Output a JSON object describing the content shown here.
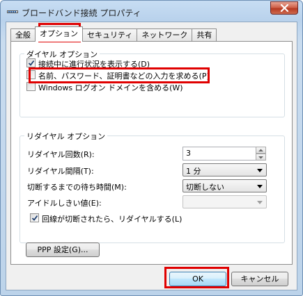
{
  "window": {
    "title": "ブロードバンド接続 プロパティ"
  },
  "tabs": [
    {
      "label": "全般",
      "active": false
    },
    {
      "label": "オプション",
      "active": true
    },
    {
      "label": "セキュリティ",
      "active": false
    },
    {
      "label": "ネットワーク",
      "active": false
    },
    {
      "label": "共有",
      "active": false
    }
  ],
  "dial_options": {
    "title": "ダイヤル オプション",
    "items": [
      {
        "label": "接続中に進行状況を表示する(D)",
        "checked": true
      },
      {
        "label": "名前、パスワード、証明書などの入力を求める(P)",
        "checked": false
      },
      {
        "label": "Windows ログオン ドメインを含める(W)",
        "checked": false,
        "disabled": true
      }
    ]
  },
  "redial_options": {
    "title": "リダイヤル オプション",
    "redial_attempts": {
      "label": "リダイヤル回数(R):",
      "value": "3"
    },
    "redial_interval": {
      "label": "リダイヤル間隔(T):",
      "value": "1 分"
    },
    "idle_time": {
      "label": "切断するまでの待ち時間(M):",
      "value": "切断しない"
    },
    "idle_threshold": {
      "label": "アイドルしきい値(E):",
      "value": ""
    },
    "redial_if_dropped": {
      "label": "回線が切断されたら、リダイヤルする(L)",
      "checked": true
    }
  },
  "buttons": {
    "ppp_settings": "PPP 設定(G)...",
    "ok": "OK",
    "cancel": "キャンセル"
  },
  "colors": {
    "highlight": "#e00000",
    "title_bar": "#b9d2ec",
    "close_button": "#c84a32"
  },
  "icons": {
    "title": "network-connection-icon",
    "close": "close-icon",
    "check": "checkmark-icon",
    "spin_up": "chevron-up-icon",
    "spin_down": "chevron-down-icon",
    "dropdown": "dropdown-arrow-icon"
  }
}
